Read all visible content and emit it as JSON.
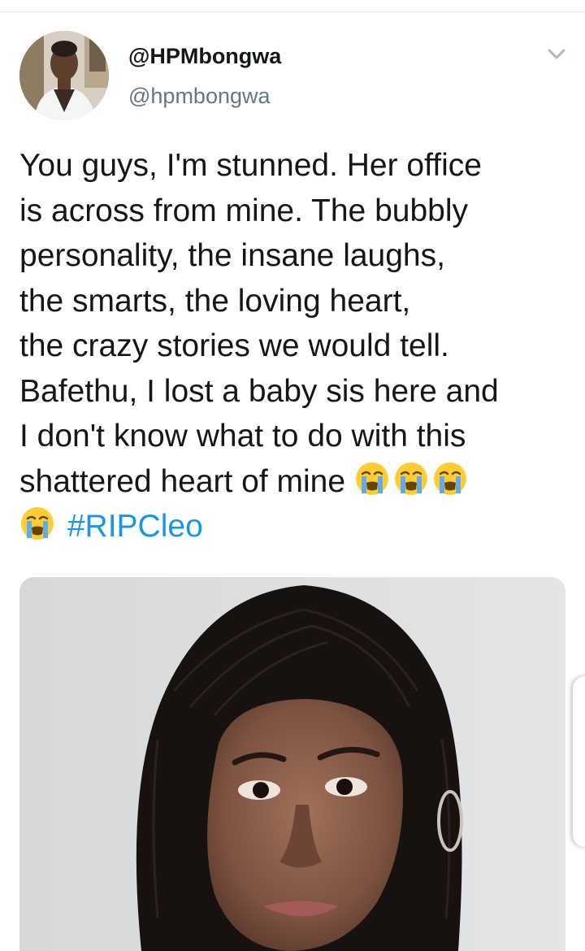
{
  "tweet": {
    "display_name": "@HPMbongwa",
    "handle": "@hpmbongwa",
    "text_lines": [
      "You guys, I'm stunned. Her office",
      "is across from mine. The bubbly",
      "personality, the insane laughs,",
      "the smarts, the loving heart,",
      "the crazy stories we would tell.",
      "Bafethu, I lost a baby sis here and",
      "I don't know what to do with this",
      "shattered heart of mine"
    ],
    "hashtag": "#RIPCleo",
    "emoji": "loudly-crying-face",
    "emoji_count_line8": 3,
    "emoji_count_line9": 1
  },
  "icons": {
    "chevron": "chevron-down-icon"
  },
  "colors": {
    "text": "#14171a",
    "secondary": "#657786",
    "link": "#1b95e0",
    "divider": "#e1e8ed"
  }
}
